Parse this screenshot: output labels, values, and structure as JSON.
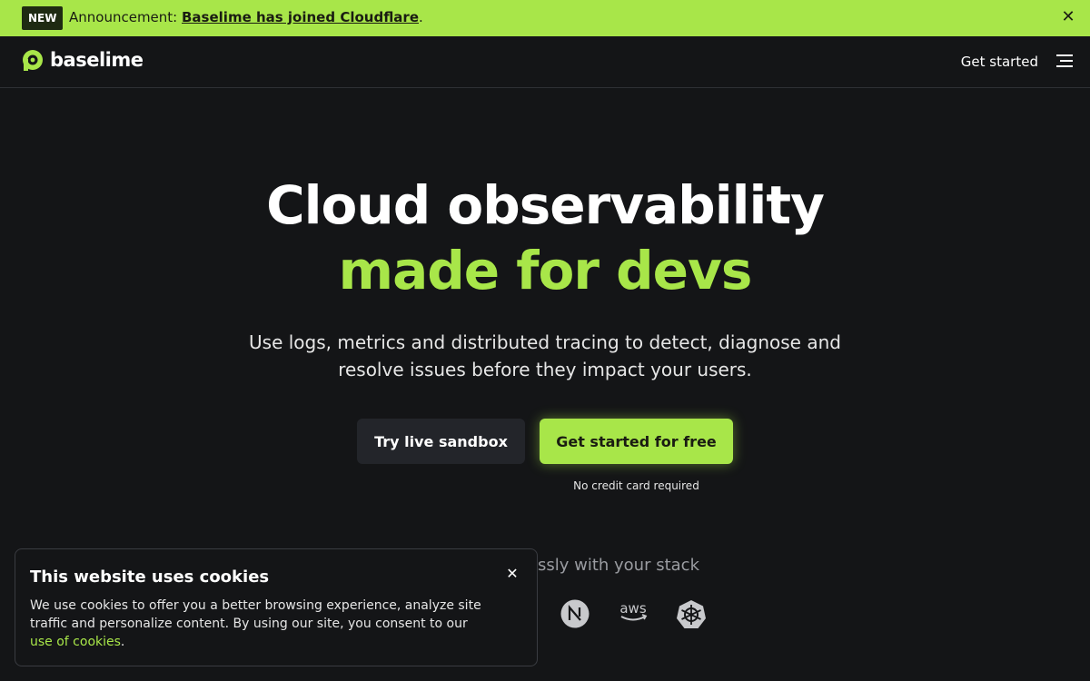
{
  "announcement": {
    "badge": "NEW",
    "prefix": "Announcement: ",
    "link_text": "Baselime has joined Cloudflare",
    "suffix": ".",
    "close_icon": "close-icon"
  },
  "navbar": {
    "brand": "baselime",
    "get_started": "Get started",
    "menu_icon": "hamburger-menu-icon"
  },
  "hero": {
    "title_line1": "Cloud observability",
    "title_line2": "made for devs",
    "subtitle": "Use logs, metrics and distributed tracing to detect, diagnose and resolve issues before they impact your users.",
    "sandbox_button": "Try live sandbox",
    "free_button": "Get started for free",
    "no_credit_card": "No credit card required"
  },
  "stack": {
    "text": "essly with your stack",
    "icons": [
      "nextjs-icon",
      "aws-icon",
      "kubernetes-icon"
    ]
  },
  "cookie": {
    "title": "This website uses cookies",
    "body": "We use cookies to offer you a better browsing experience, analyze site traffic and personalize content. By using our site, you consent to our ",
    "link_text": "use of cookies",
    "suffix": ".",
    "close_icon": "close-icon"
  },
  "colors": {
    "accent": "#a8e649",
    "background": "#141517",
    "button_dark": "#23252a"
  }
}
